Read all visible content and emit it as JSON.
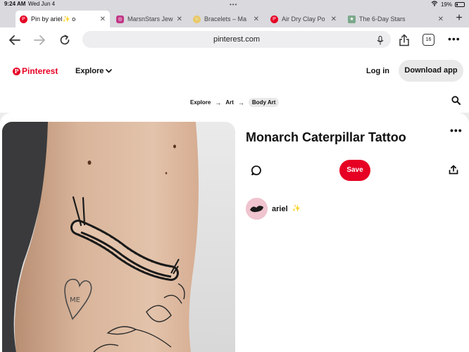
{
  "status_bar": {
    "time": "9:24 AM",
    "date": "Wed Jun 4",
    "battery": "19%"
  },
  "tabs": [
    {
      "label": "Pin by ariel✨ o",
      "favicon": "pinterest-icon",
      "color": "#e60023",
      "active": true
    },
    {
      "label": "MarsnStars Jew",
      "favicon": "instagram-icon",
      "color": "#c13584",
      "active": false
    },
    {
      "label": "Bracelets – Ma",
      "favicon": "bracelet-icon",
      "color": "#e8c96a",
      "active": false
    },
    {
      "label": "Air Dry Clay Po",
      "favicon": "pinterest-icon",
      "color": "#e60023",
      "active": false
    },
    {
      "label": "The 6-Day Stars",
      "favicon": "site-icon",
      "color": "#7aa88a",
      "active": false
    }
  ],
  "browser": {
    "url": "pinterest.com",
    "tab_count": "16"
  },
  "header": {
    "logo": "Pinterest",
    "explore": "Explore",
    "login": "Log in",
    "download": "Download app"
  },
  "breadcrumb": [
    "Explore",
    "Art",
    "Body Art"
  ],
  "pin": {
    "title": "Monarch Caterpillar Tattoo",
    "save_label": "Save",
    "creator": "ariel",
    "creator_sparkle": "✨",
    "heart_text": "ME"
  },
  "colors": {
    "brand": "#e60023",
    "chip": "#e9e9e9",
    "tab_bar": "#d9d9de"
  }
}
